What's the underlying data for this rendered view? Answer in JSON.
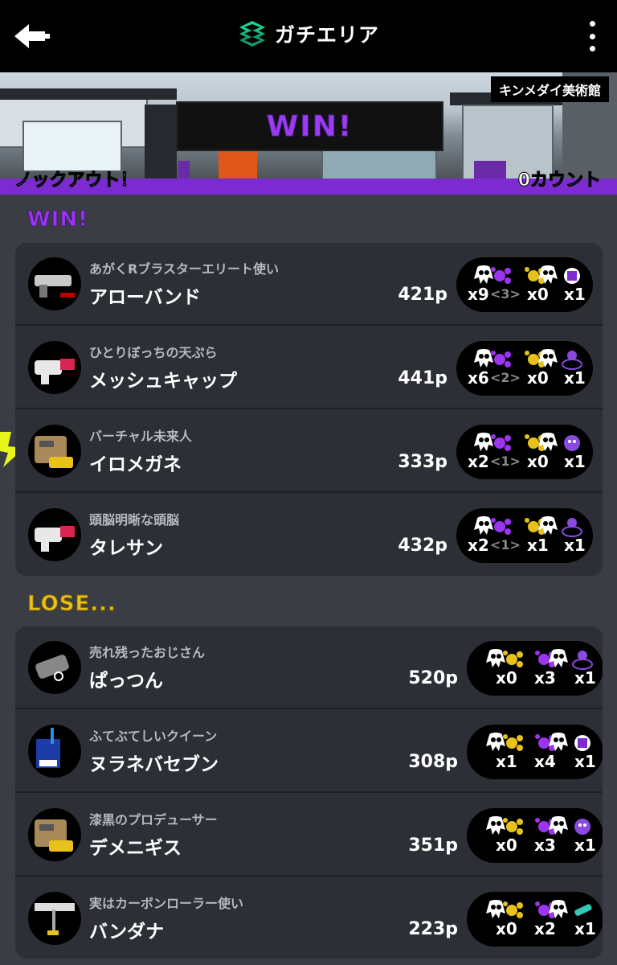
{
  "header": {
    "title": "ガチエリア",
    "back_icon": "back-arrow-icon",
    "menu_icon": "more-vert-icon"
  },
  "banner": {
    "stage": "キンメダイ美術館",
    "result": "WIN!",
    "rule_result": "ノックアウト！",
    "count": "0カウント"
  },
  "colors": {
    "win": "#9c35f0",
    "lose": "#e8c21a",
    "ink_purple": "#7b2bd0"
  },
  "teams": {
    "win": {
      "label": "WIN!",
      "players": [
        {
          "title": "あがくRブラスターエリート使い",
          "name": "アローバンド",
          "points": "421p",
          "kills": "x9",
          "assists": "<3>",
          "deaths": "x0",
          "specials": "x1",
          "weapon": "rapid-blaster-elite-icon",
          "special": "ink-armor-icon"
        },
        {
          "title": "ひとりぼっちの天ぷら",
          "name": "メッシュキャップ",
          "points": "441p",
          "kills": "x6",
          "assists": "<2>",
          "deaths": "x0",
          "specials": "x1",
          "weapon": "splattershot-icon",
          "special": "splashdown-icon"
        },
        {
          "title": "バーチャル未来人",
          "name": "イロメガネ",
          "points": "333p",
          "kills": "x2",
          "assists": "<1>",
          "deaths": "x0",
          "specials": "x1",
          "weapon": "kensa-gun-icon",
          "special": "booyah-bomb-icon"
        },
        {
          "title": "頭脳明晰な頭脳",
          "name": "タレサン",
          "points": "432p",
          "kills": "x2",
          "assists": "<1>",
          "deaths": "x1",
          "specials": "x1",
          "weapon": "splattershot-icon",
          "special": "splashdown-icon"
        }
      ]
    },
    "lose": {
      "label": "LOSE...",
      "players": [
        {
          "title": "売れ残ったおじさん",
          "name": "ぱっつん",
          "points": "520p",
          "kills": "x0",
          "deaths": "x3",
          "specials": "x1",
          "weapon": "dualies-icon",
          "special": "splashdown-icon"
        },
        {
          "title": "ふてぶてしいクイーン",
          "name": "ヌラネバセブン",
          "points": "308p",
          "kills": "x1",
          "deaths": "x4",
          "specials": "x1",
          "weapon": "squiffer-icon",
          "special": "ink-armor-icon"
        },
        {
          "title": "漆黒のプロデューサー",
          "name": "デメニギス",
          "points": "351p",
          "kills": "x0",
          "deaths": "x3",
          "specials": "x1",
          "weapon": "kensa-gun-icon",
          "special": "booyah-bomb-icon"
        },
        {
          "title": "実はカーボンローラー使い",
          "name": "バンダナ",
          "points": "223p",
          "kills": "x0",
          "deaths": "x2",
          "specials": "x1",
          "weapon": "carbon-roller-icon",
          "special": "sting-ray-icon"
        }
      ]
    }
  }
}
